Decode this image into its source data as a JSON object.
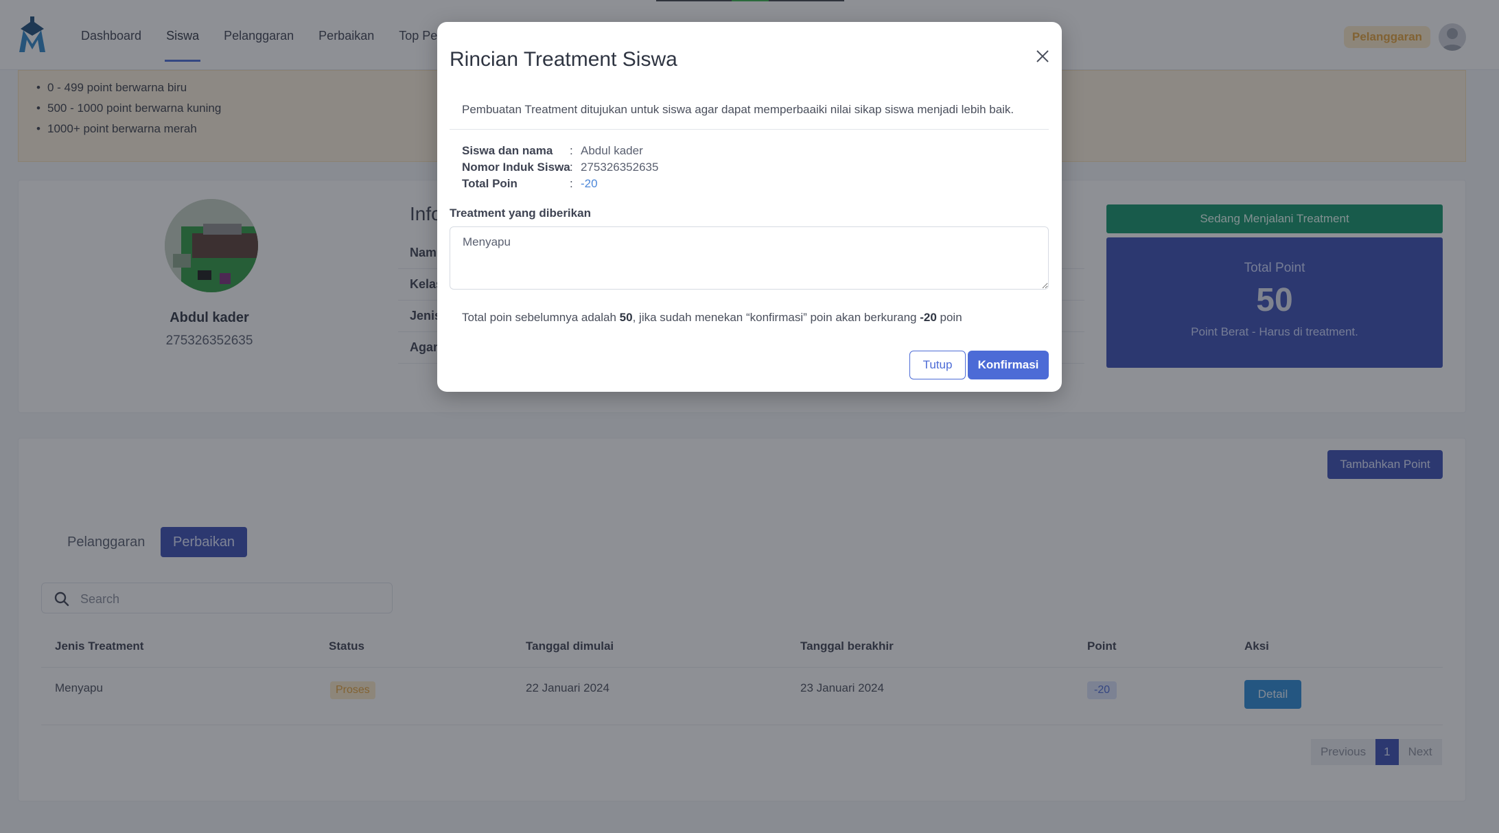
{
  "navbar": {
    "links": [
      "Dashboard",
      "Siswa",
      "Pelanggaran",
      "Perbaikan",
      "Top Pelang"
    ],
    "active_link": "Siswa",
    "badge": "Pelanggaran"
  },
  "legend": {
    "items": [
      "0 - 499 point berwarna biru",
      "500 - 1000 point berwarna kuning",
      "1000+ point berwarna merah"
    ]
  },
  "profile": {
    "name": "Abdul kader",
    "nis": "275326352635",
    "info_title": "Info",
    "info_labels": [
      "Nam",
      "Kelas",
      "Jenis",
      "Agam"
    ]
  },
  "status_card": {
    "status": "Sedang Menjalani Treatment",
    "point_label": "Total Point",
    "point_value": "50",
    "point_desc": "Point Berat - Harus di treatment."
  },
  "table": {
    "add_button": "Tambahkan Point",
    "tabs": [
      "Pelanggaran",
      "Perbaikan"
    ],
    "active_tab": "Perbaikan",
    "search_placeholder": "Search",
    "headers": [
      "Jenis Treatment",
      "Status",
      "Tanggal dimulai",
      "Tanggal berakhir",
      "Point",
      "Aksi"
    ],
    "rows": [
      {
        "jenis": "Menyapu",
        "status": "Proses",
        "mulai": "22 Januari 2024",
        "akhir": "23 Januari 2024",
        "point": "-20",
        "aksi": "Detail"
      }
    ],
    "pager": {
      "previous": "Previous",
      "current": "1",
      "next": "Next"
    }
  },
  "modal": {
    "title": "Rincian Treatment Siswa",
    "description": "Pembuatan Treatment ditujukan untuk siswa agar dapat memperbaaiki nilai sikap siswa menjadi lebih baik.",
    "fields": [
      {
        "key": "Siswa dan nama",
        "value": "Abdul kader"
      },
      {
        "key": "Nomor Induk Siswa",
        "value": "275326352635"
      },
      {
        "key": "Total Poin",
        "value": "-20"
      }
    ],
    "separator": ":",
    "treatment_label": "Treatment yang diberikan",
    "treatment_value": "Menyapu",
    "note": {
      "prefix": "Total poin sebelumnya adalah ",
      "previous_points": "50",
      "middle": ", jika sudah menekan “konfirmasi” poin akan berkurang ",
      "reduction": "-20",
      "suffix": " poin"
    },
    "cancel_button": "Tutup",
    "confirm_button": "Konfirmasi"
  },
  "colors": {
    "primary": "#3a4fb4",
    "modal_primary": "#4c6bd6",
    "success": "#13946b",
    "warning_bg": "#fdebc9",
    "warning_text": "#e4a23a",
    "detail_button": "#2b8bd6"
  }
}
